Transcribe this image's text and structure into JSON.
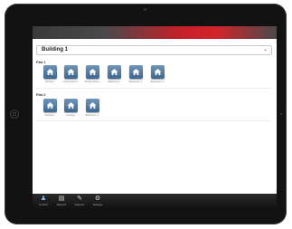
{
  "building_selector": {
    "value": "Building 1"
  },
  "sections": [
    {
      "title": "Flat 1",
      "rooms": [
        "Kitchen",
        "Living Room",
        "Dining Room",
        "Bathroom",
        "Bedroom 1",
        "Bedroom 2"
      ]
    },
    {
      "title": "Flat 2",
      "rooms": [
        "Kitchen",
        "Lounge",
        "Bedroom 1"
      ]
    }
  ],
  "tabs": [
    "Control",
    "Reports",
    "Support",
    "Settings"
  ],
  "colors": {
    "accent": "#c41f28",
    "tile": "#4f7aa3"
  }
}
